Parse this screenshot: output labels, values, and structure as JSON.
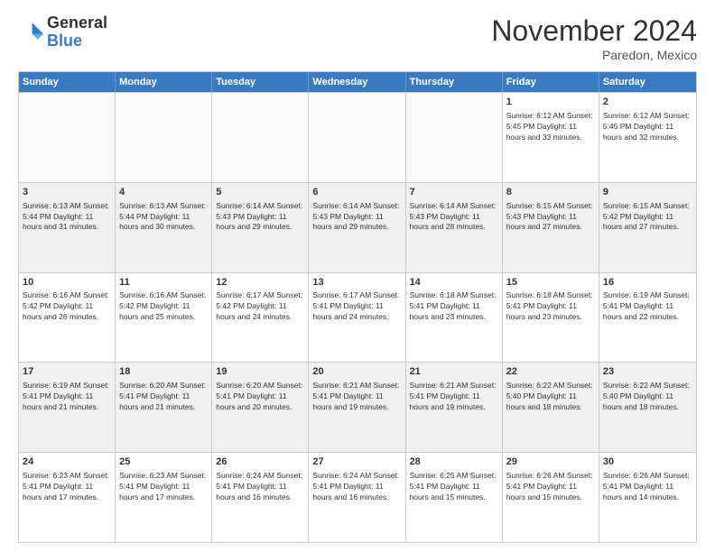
{
  "header": {
    "logo_general": "General",
    "logo_blue": "Blue",
    "month_title": "November 2024",
    "location": "Paredon, Mexico"
  },
  "weekdays": [
    "Sunday",
    "Monday",
    "Tuesday",
    "Wednesday",
    "Thursday",
    "Friday",
    "Saturday"
  ],
  "rows": [
    [
      {
        "day": "",
        "empty": true
      },
      {
        "day": "",
        "empty": true
      },
      {
        "day": "",
        "empty": true
      },
      {
        "day": "",
        "empty": true
      },
      {
        "day": "",
        "empty": true
      },
      {
        "day": "1",
        "text": "Sunrise: 6:12 AM\nSunset: 5:45 PM\nDaylight: 11 hours and 33 minutes."
      },
      {
        "day": "2",
        "text": "Sunrise: 6:12 AM\nSunset: 5:45 PM\nDaylight: 11 hours and 32 minutes."
      }
    ],
    [
      {
        "day": "3",
        "text": "Sunrise: 6:13 AM\nSunset: 5:44 PM\nDaylight: 11 hours and 31 minutes."
      },
      {
        "day": "4",
        "text": "Sunrise: 6:13 AM\nSunset: 5:44 PM\nDaylight: 11 hours and 30 minutes."
      },
      {
        "day": "5",
        "text": "Sunrise: 6:14 AM\nSunset: 5:43 PM\nDaylight: 11 hours and 29 minutes."
      },
      {
        "day": "6",
        "text": "Sunrise: 6:14 AM\nSunset: 5:43 PM\nDaylight: 11 hours and 29 minutes."
      },
      {
        "day": "7",
        "text": "Sunrise: 6:14 AM\nSunset: 5:43 PM\nDaylight: 11 hours and 28 minutes."
      },
      {
        "day": "8",
        "text": "Sunrise: 6:15 AM\nSunset: 5:43 PM\nDaylight: 11 hours and 27 minutes."
      },
      {
        "day": "9",
        "text": "Sunrise: 6:15 AM\nSunset: 5:42 PM\nDaylight: 11 hours and 27 minutes."
      }
    ],
    [
      {
        "day": "10",
        "text": "Sunrise: 6:16 AM\nSunset: 5:42 PM\nDaylight: 11 hours and 26 minutes."
      },
      {
        "day": "11",
        "text": "Sunrise: 6:16 AM\nSunset: 5:42 PM\nDaylight: 11 hours and 25 minutes."
      },
      {
        "day": "12",
        "text": "Sunrise: 6:17 AM\nSunset: 5:42 PM\nDaylight: 11 hours and 24 minutes."
      },
      {
        "day": "13",
        "text": "Sunrise: 6:17 AM\nSunset: 5:41 PM\nDaylight: 11 hours and 24 minutes."
      },
      {
        "day": "14",
        "text": "Sunrise: 6:18 AM\nSunset: 5:41 PM\nDaylight: 11 hours and 23 minutes."
      },
      {
        "day": "15",
        "text": "Sunrise: 6:18 AM\nSunset: 5:41 PM\nDaylight: 11 hours and 23 minutes."
      },
      {
        "day": "16",
        "text": "Sunrise: 6:19 AM\nSunset: 5:41 PM\nDaylight: 11 hours and 22 minutes."
      }
    ],
    [
      {
        "day": "17",
        "text": "Sunrise: 6:19 AM\nSunset: 5:41 PM\nDaylight: 11 hours and 21 minutes."
      },
      {
        "day": "18",
        "text": "Sunrise: 6:20 AM\nSunset: 5:41 PM\nDaylight: 11 hours and 21 minutes."
      },
      {
        "day": "19",
        "text": "Sunrise: 6:20 AM\nSunset: 5:41 PM\nDaylight: 11 hours and 20 minutes."
      },
      {
        "day": "20",
        "text": "Sunrise: 6:21 AM\nSunset: 5:41 PM\nDaylight: 11 hours and 19 minutes."
      },
      {
        "day": "21",
        "text": "Sunrise: 6:21 AM\nSunset: 5:41 PM\nDaylight: 11 hours and 19 minutes."
      },
      {
        "day": "22",
        "text": "Sunrise: 6:22 AM\nSunset: 5:40 PM\nDaylight: 11 hours and 18 minutes."
      },
      {
        "day": "23",
        "text": "Sunrise: 6:22 AM\nSunset: 5:40 PM\nDaylight: 11 hours and 18 minutes."
      }
    ],
    [
      {
        "day": "24",
        "text": "Sunrise: 6:23 AM\nSunset: 5:41 PM\nDaylight: 11 hours and 17 minutes."
      },
      {
        "day": "25",
        "text": "Sunrise: 6:23 AM\nSunset: 5:41 PM\nDaylight: 11 hours and 17 minutes."
      },
      {
        "day": "26",
        "text": "Sunrise: 6:24 AM\nSunset: 5:41 PM\nDaylight: 11 hours and 16 minutes."
      },
      {
        "day": "27",
        "text": "Sunrise: 6:24 AM\nSunset: 5:41 PM\nDaylight: 11 hours and 16 minutes."
      },
      {
        "day": "28",
        "text": "Sunrise: 6:25 AM\nSunset: 5:41 PM\nDaylight: 11 hours and 15 minutes."
      },
      {
        "day": "29",
        "text": "Sunrise: 6:26 AM\nSunset: 5:41 PM\nDaylight: 11 hours and 15 minutes."
      },
      {
        "day": "30",
        "text": "Sunrise: 6:26 AM\nSunset: 5:41 PM\nDaylight: 11 hours and 14 minutes."
      }
    ]
  ]
}
